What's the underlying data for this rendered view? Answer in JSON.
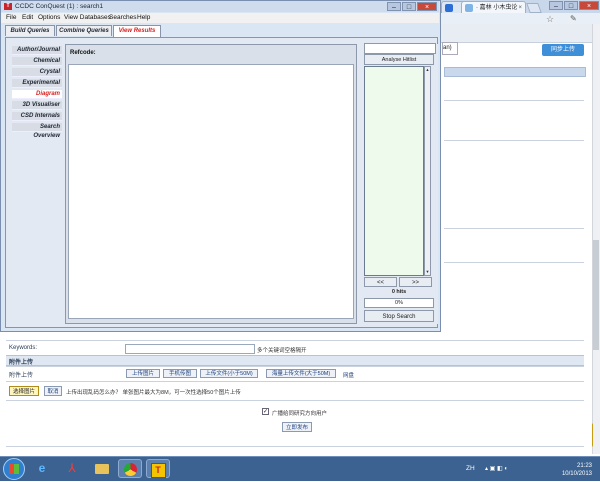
{
  "browser": {
    "tabs": [
      {
        "label": ""
      },
      {
        "label": "· 嘉林 小木虫论"
      }
    ],
    "page": {
      "input_fragment": "an)",
      "share_button": "同步上传",
      "keywords_label": "Keywords:",
      "keywords_hint": "多个关键词空格隔开",
      "attach_section_title": "附件上传",
      "attach_row_label": "附件上传",
      "upload_buttons": [
        "上传图片",
        "手机传图",
        "上传文件(小于50M)",
        "海量上传文件(大于50M)"
      ],
      "upload_extra": "网盘",
      "select_image": "选择图片",
      "cancel": "取消",
      "upload_note": "上传出现乱码怎么办？ 单张图片最大为8M，可一次性选择50个图片上传",
      "checkbox_label": "广播给同研究方向用户",
      "publish": "立即发布"
    }
  },
  "ccdc": {
    "title": "CCDC ConQuest (1) : search1",
    "menu": [
      "File",
      "Edit",
      "Options",
      "View Databases",
      "Searches",
      "Help"
    ],
    "tabs": [
      "Build Queries",
      "Combine Queries",
      "View Results"
    ],
    "active_tab": "View Results",
    "sidenav": [
      "Author/Journal",
      "Chemical",
      "Crystal",
      "Experimental",
      "Diagram",
      "3D Visualiser",
      "CSD Internals",
      "Search Overview"
    ],
    "active_sidenav": "Diagram",
    "refcode_label": "Refcode:",
    "analyse_button": "Analyse Hitlist",
    "prev_button": "<<",
    "next_button": ">>",
    "hits": "0 hits",
    "progress_text": "0%",
    "progress_value": 0,
    "stop_button": "Stop Search"
  },
  "taskbar": {
    "lang": "ZH",
    "time": "21:23",
    "date": "10/10/2013"
  }
}
